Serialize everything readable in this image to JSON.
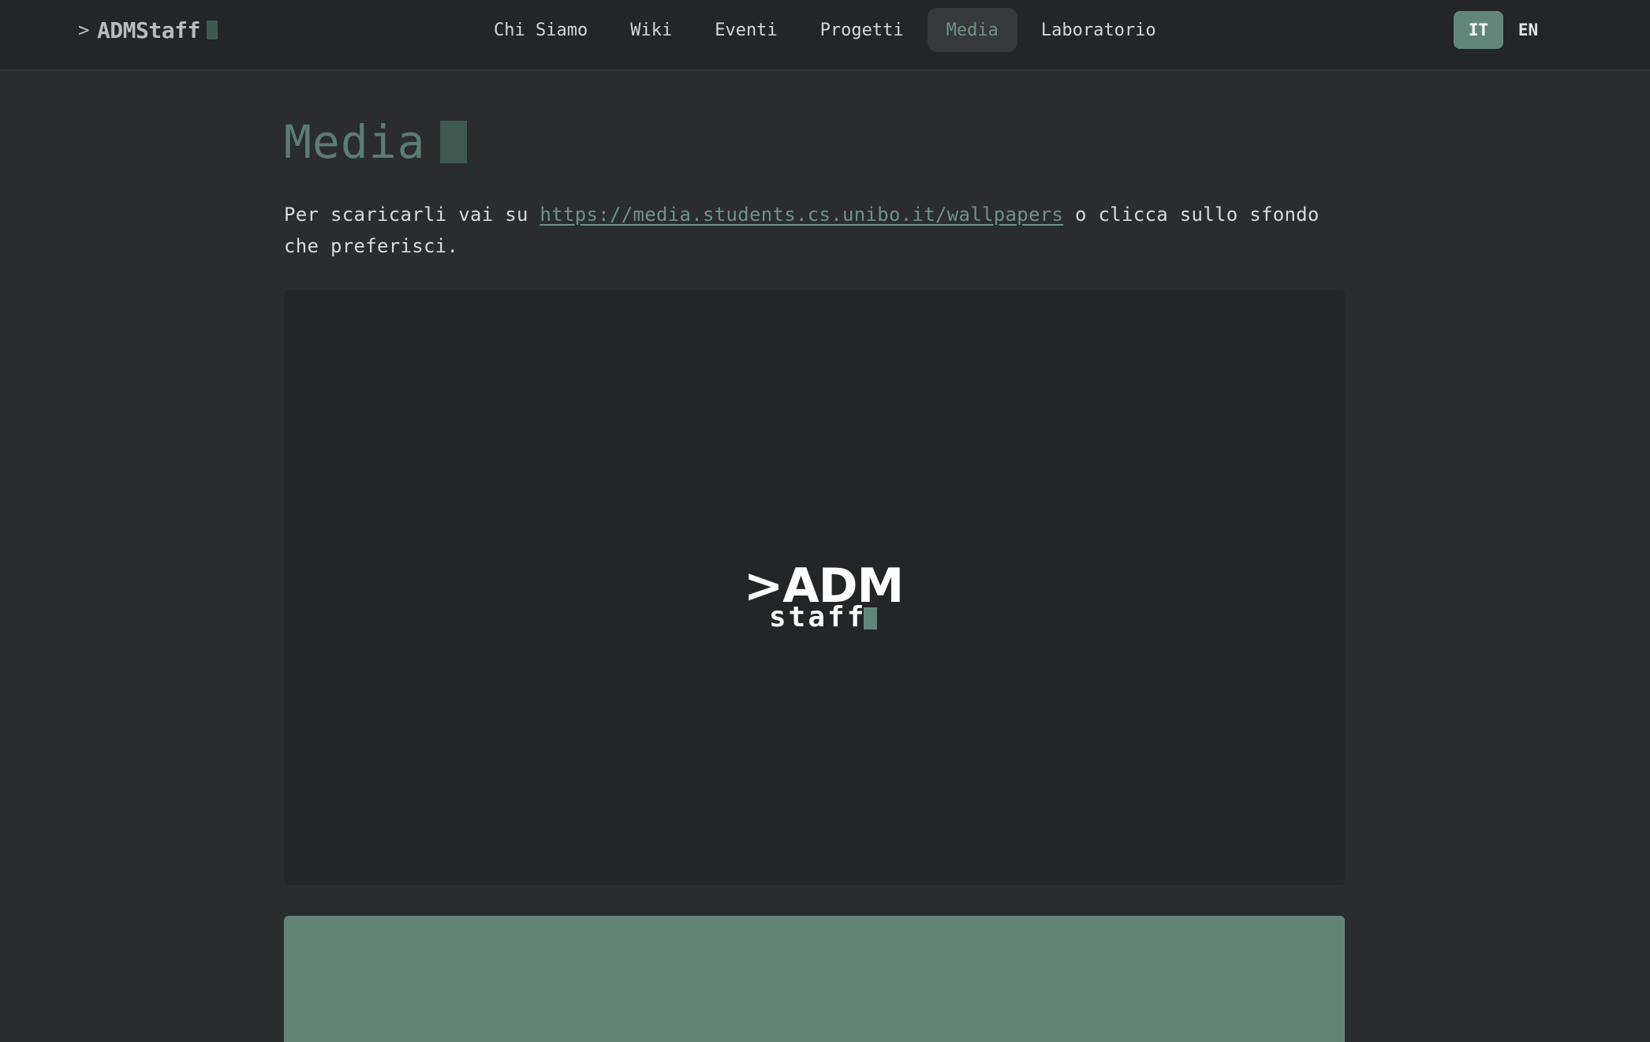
{
  "header": {
    "brand_prompt": ">",
    "brand_name": "ADMStaff",
    "nav": [
      {
        "label": "Chi Siamo"
      },
      {
        "label": "Wiki"
      },
      {
        "label": "Eventi"
      },
      {
        "label": "Progetti"
      },
      {
        "label": "Media"
      },
      {
        "label": "Laboratorio"
      }
    ],
    "active_nav": "Media",
    "languages": [
      "IT",
      "EN"
    ],
    "active_language": "IT"
  },
  "main": {
    "title": "Media",
    "intro_before": "Per scaricarli vai su ",
    "intro_link": "https://media.students.cs.unibo.it/wallpapers",
    "intro_after": " o clicca sullo sfondo che preferisci."
  },
  "wallpapers": [
    {
      "logo_text_top": ">ADM",
      "logo_text_bottom": "staff",
      "background_color": "#242527"
    },
    {
      "background_color": "#618476"
    }
  ],
  "colors": {
    "accent": "#62877a",
    "accent_text": "#6f9284",
    "background": "#2a2c30",
    "navbar": "#242528"
  }
}
